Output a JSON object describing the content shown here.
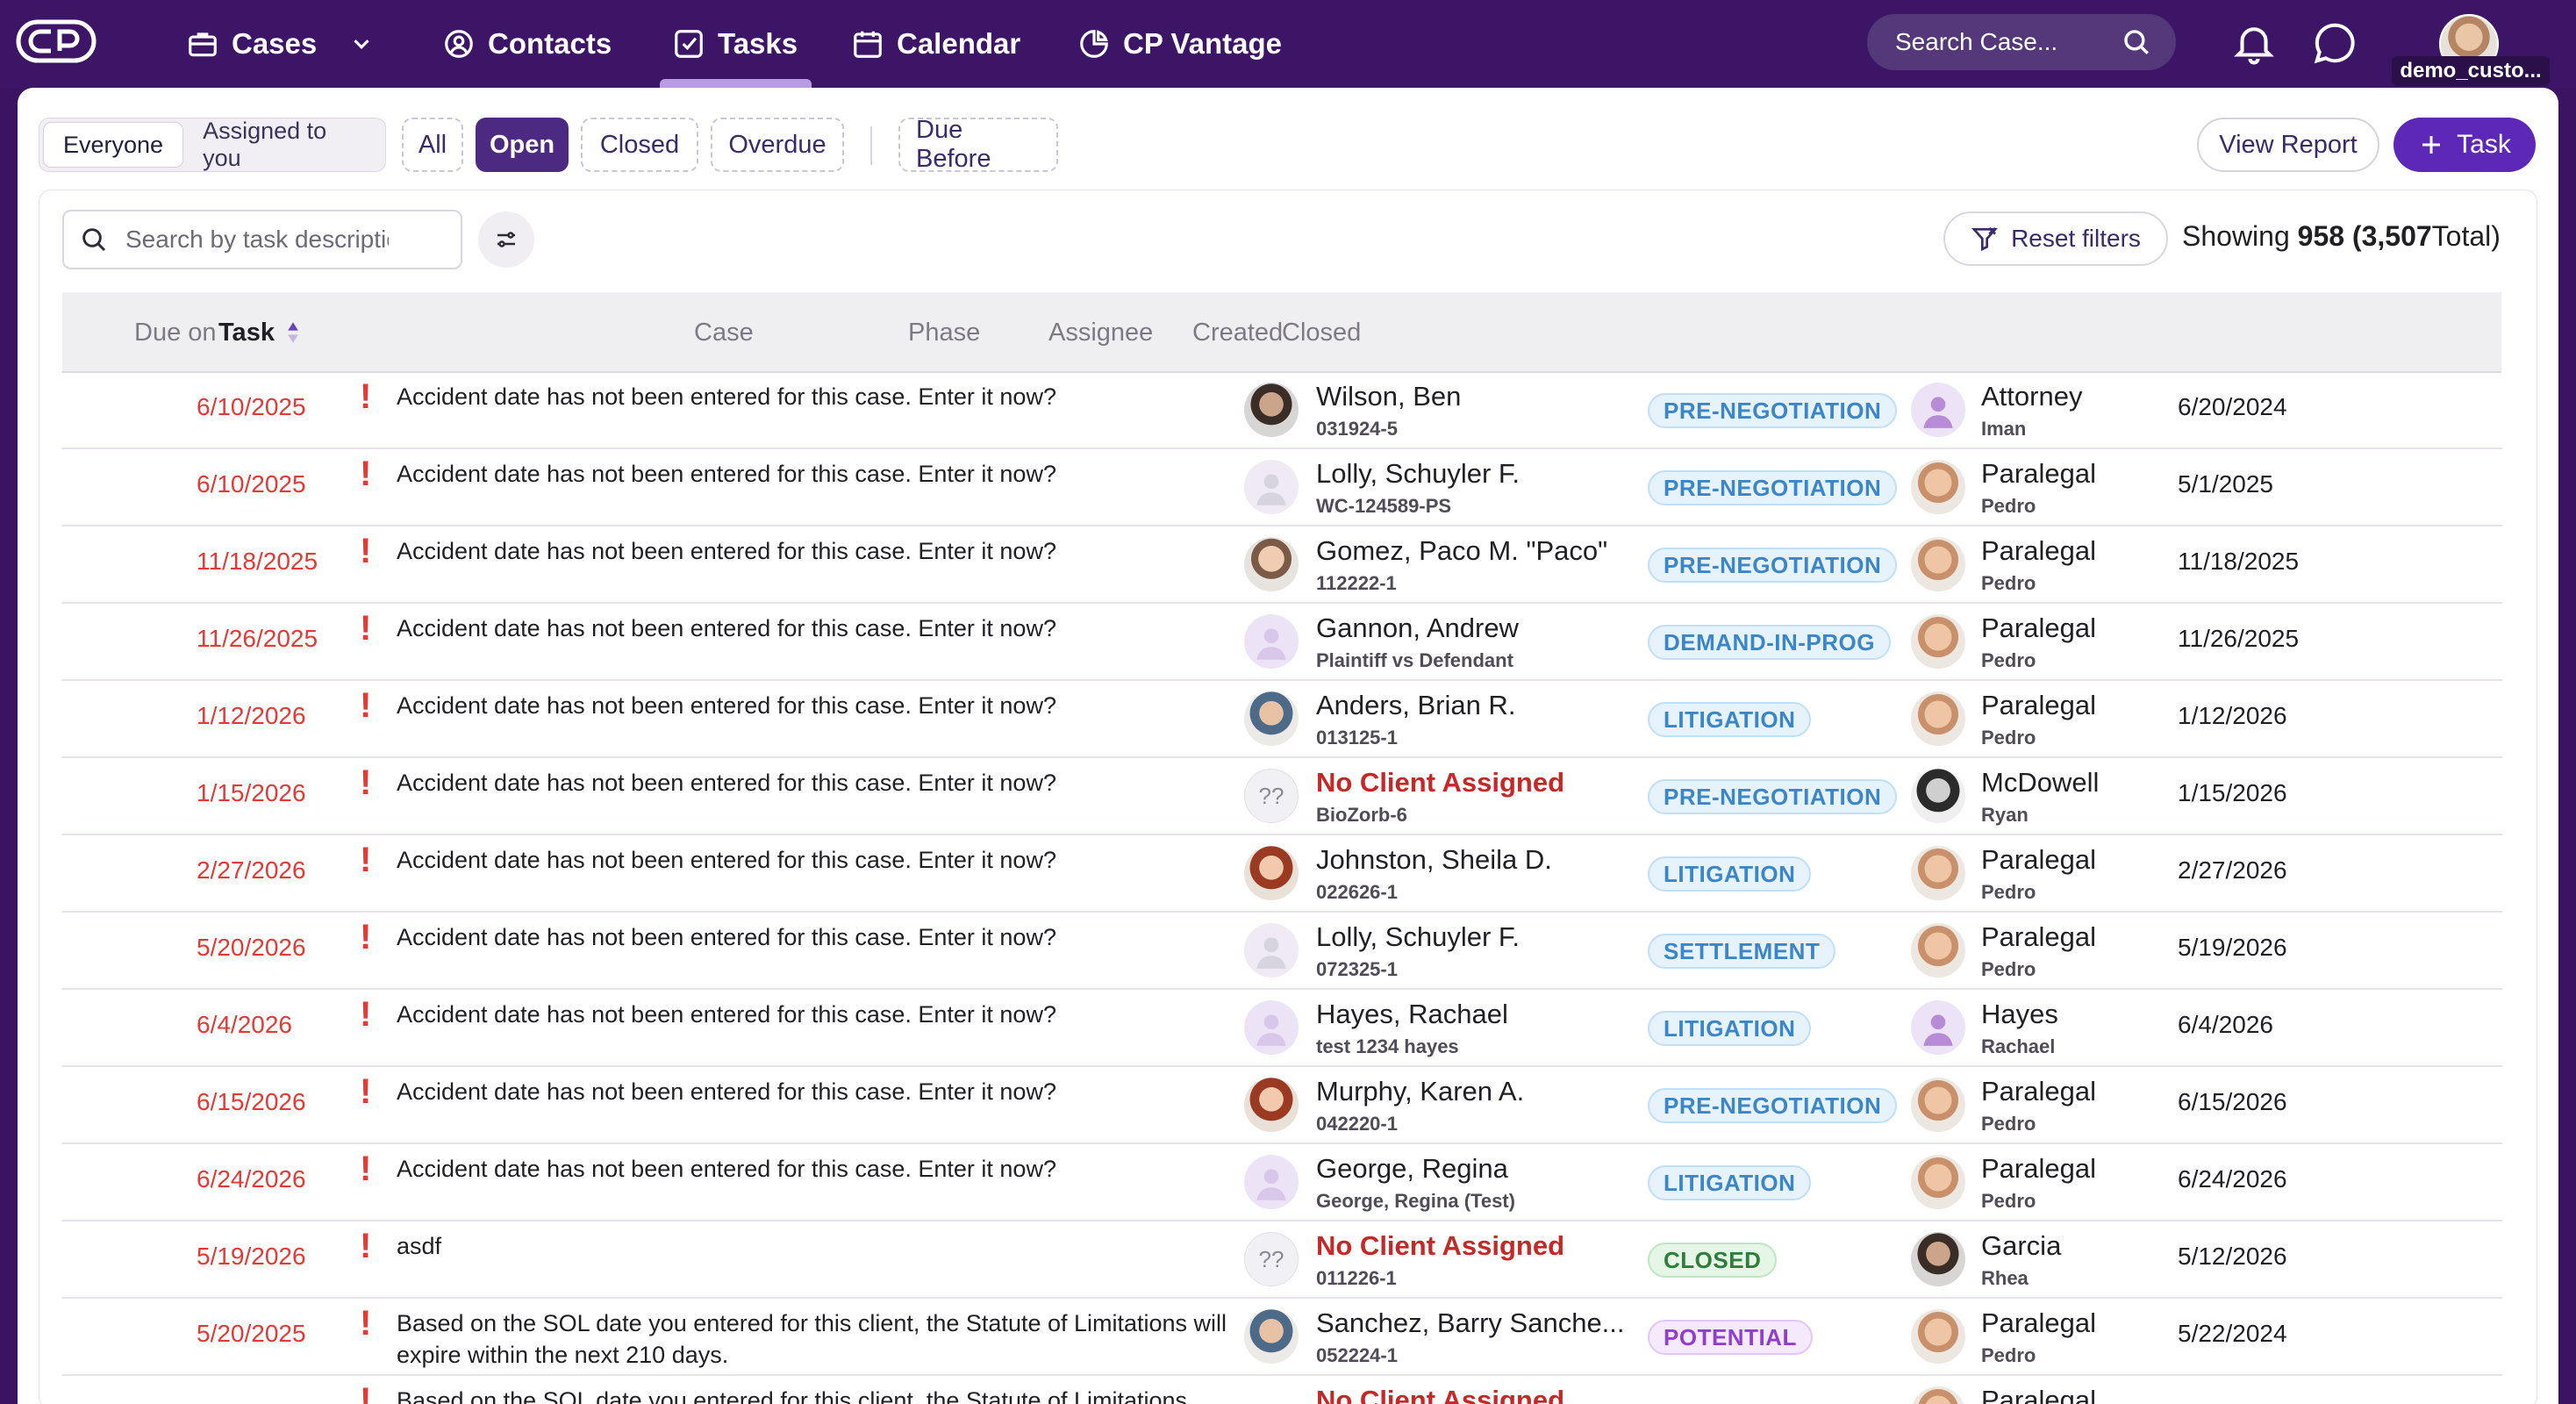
{
  "nav": {
    "cases": "Cases",
    "contacts": "Contacts",
    "tasks": "Tasks",
    "calendar": "Calendar",
    "vantage": "CP Vantage",
    "search_placeholder": "Search Case...",
    "user_label": "demo_custo..."
  },
  "toolbar": {
    "everyone": "Everyone",
    "assigned": "Assigned to you",
    "all": "All",
    "open": "Open",
    "closed": "Closed",
    "overdue": "Overdue",
    "due_before": "Due Before",
    "view_report": "View Report",
    "add_task": "Task"
  },
  "card": {
    "search_placeholder": "Search by task description",
    "reset_filters": "Reset filters",
    "showing_prefix": "Showing",
    "showing_count": "958",
    "showing_total": "(3,507",
    "showing_suffix": "Total)"
  },
  "columns": {
    "due_on": "Due on",
    "task": "Task",
    "case": "Case",
    "phase": "Phase",
    "assignee": "Assignee",
    "created": "Created",
    "closed": "Closed"
  },
  "colors": {
    "brand": "#3c1566",
    "accent": "#5d28b8",
    "overdue": "#e53935"
  },
  "rows": [
    {
      "due": "6/10/2025",
      "task": "Accident date has not been entered for this case. Enter it now?",
      "client": "Wilson, Ben",
      "case": "031924-5",
      "phase": "PRE-NEGOTIATION",
      "assignee": "Attorney",
      "assignee_sub": "Iman",
      "created": "6/20/2024"
    },
    {
      "due": "6/10/2025",
      "task": "Accident date has not been entered for this case. Enter it now?",
      "client": "Lolly, Schuyler F.",
      "case": "WC-124589-PS",
      "phase": "PRE-NEGOTIATION",
      "assignee": "Paralegal",
      "assignee_sub": "Pedro",
      "created": "5/1/2025"
    },
    {
      "due": "11/18/2025",
      "task": "Accident date has not been entered for this case. Enter it now?",
      "client": "Gomez, Paco M. \"Paco\"",
      "case": "112222-1",
      "phase": "PRE-NEGOTIATION",
      "assignee": "Paralegal",
      "assignee_sub": "Pedro",
      "created": "11/18/2025"
    },
    {
      "due": "11/26/2025",
      "task": "Accident date has not been entered for this case. Enter it now?",
      "client": "Gannon, Andrew",
      "case": "Plaintiff vs Defendant",
      "phase": "DEMAND-IN-PROG",
      "assignee": "Paralegal",
      "assignee_sub": "Pedro",
      "created": "11/26/2025"
    },
    {
      "due": "1/12/2026",
      "task": "Accident date has not been entered for this case. Enter it now?",
      "client": "Anders, Brian R.",
      "case": "013125-1",
      "phase": "LITIGATION",
      "assignee": "Paralegal",
      "assignee_sub": "Pedro",
      "created": "1/12/2026"
    },
    {
      "due": "1/15/2026",
      "task": "Accident date has not been entered for this case. Enter it now?",
      "client": "No Client Assigned",
      "case": "BioZorb-6",
      "phase": "PRE-NEGOTIATION",
      "assignee": "McDowell",
      "assignee_sub": "Ryan",
      "created": "1/15/2026"
    },
    {
      "due": "2/27/2026",
      "task": "Accident date has not been entered for this case. Enter it now?",
      "client": "Johnston, Sheila D.",
      "case": "022626-1",
      "phase": "LITIGATION",
      "assignee": "Paralegal",
      "assignee_sub": "Pedro",
      "created": "2/27/2026"
    },
    {
      "due": "5/20/2026",
      "task": "Accident date has not been entered for this case. Enter it now?",
      "client": "Lolly, Schuyler F.",
      "case": "072325-1",
      "phase": "SETTLEMENT",
      "assignee": "Paralegal",
      "assignee_sub": "Pedro",
      "created": "5/19/2026"
    },
    {
      "due": "6/4/2026",
      "task": "Accident date has not been entered for this case. Enter it now?",
      "client": "Hayes, Rachael",
      "case": "test 1234 hayes",
      "phase": "LITIGATION",
      "assignee": "Hayes",
      "assignee_sub": "Rachael",
      "created": "6/4/2026"
    },
    {
      "due": "6/15/2026",
      "task": "Accident date has not been entered for this case. Enter it now?",
      "client": "Murphy, Karen A.",
      "case": "042220-1",
      "phase": "PRE-NEGOTIATION",
      "assignee": "Paralegal",
      "assignee_sub": "Pedro",
      "created": "6/15/2026"
    },
    {
      "due": "6/24/2026",
      "task": "Accident date has not been entered for this case. Enter it now?",
      "client": "George, Regina",
      "case": "George, Regina (Test)",
      "phase": "LITIGATION",
      "assignee": "Paralegal",
      "assignee_sub": "Pedro",
      "created": "6/24/2026"
    },
    {
      "due": "5/19/2026",
      "task": "asdf",
      "client": "No Client Assigned",
      "case": "011226-1",
      "phase": "CLOSED",
      "assignee": "Garcia",
      "assignee_sub": "Rhea",
      "created": "5/12/2026"
    },
    {
      "due": "5/20/2025",
      "task": "Based on the SOL date you entered for this client, the Statute of Limitations will expire within the next 210 days.",
      "client": "Sanchez, Barry Sanche...",
      "case": "052224-1",
      "phase": "POTENTIAL",
      "assignee": "Paralegal",
      "assignee_sub": "Pedro",
      "created": "5/22/2024"
    },
    {
      "due": "",
      "task": "Based on the SOL date you entered for this client, the Statute of Limitations",
      "client": "No Client Assigned",
      "case": "",
      "phase": "",
      "assignee": "Paralegal",
      "assignee_sub": "",
      "created": ""
    }
  ]
}
